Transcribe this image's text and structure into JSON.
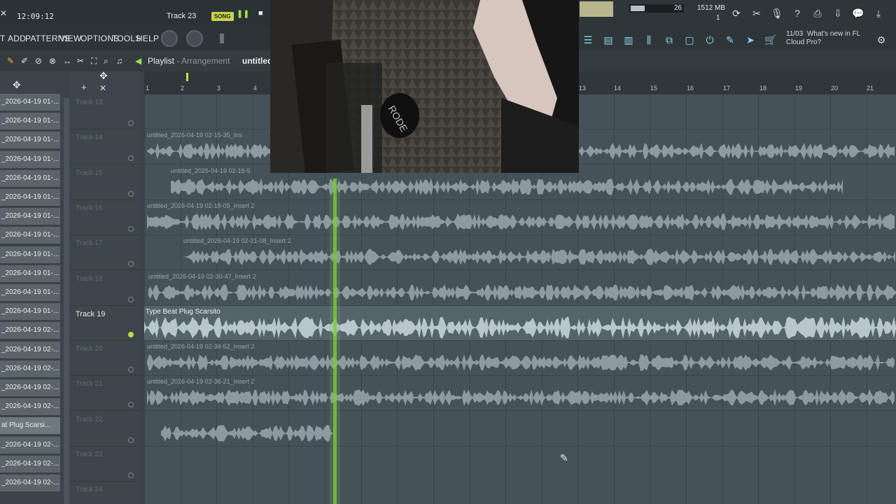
{
  "topbar": {
    "clock": "12:09:12",
    "track_hint": "Track 23",
    "song_mode": "SONG",
    "cpu_value": "26",
    "memory": "1512 MB",
    "poly": "1"
  },
  "menu": [
    "T",
    "ADD",
    "PATTERNS",
    "VIEW",
    "OPTIONS",
    "TOOLS",
    "HELP"
  ],
  "news": {
    "date": "11/03",
    "text_line1": "What's new in FL",
    "text_line2": "Cloud Pro?"
  },
  "playlist": {
    "title": "Playlist",
    "subtitle": "Arrangement",
    "project": "untitled"
  },
  "picker_items": [
    "_2026-04-19 01-...",
    "_2026-04-19 01-...",
    "_2026-04-19 01-...",
    "_2026-04-19 01-...",
    "_2026-04-19 01-...",
    "_2026-04-19 01-...",
    "_2026-04-19 01-...",
    "_2026-04-19 01-...",
    "_2026-04-19 01-...",
    "_2026-04-19 01-...",
    "_2026-04-19 01-...",
    "_2026-04-19 01-...",
    "_2026-04-19 02-...",
    "_2026-04-19 02-...",
    "_2026-04-19 02-...",
    "_2026-04-19 02-...",
    "_2026-04-19 02-...",
    "at Plug Scarsi...",
    "_2026-04-19 02-...",
    "_2026-04-19 02-...",
    "_2026-04-19 02-..."
  ],
  "tracks": [
    {
      "name": "Track 13"
    },
    {
      "name": "Track 14"
    },
    {
      "name": "Track 15"
    },
    {
      "name": "Track 16"
    },
    {
      "name": "Track 17"
    },
    {
      "name": "Track 18"
    },
    {
      "name": "Track 19"
    },
    {
      "name": "Track 20"
    },
    {
      "name": "Track 21"
    },
    {
      "name": "Track 22"
    },
    {
      "name": "Track 23"
    },
    {
      "name": "Track 24"
    }
  ],
  "clips": [
    {
      "label": "untitled_2026-04-19 02-15-35_Ins"
    },
    {
      "label": "untitled_2026-04-19 02-16-5"
    },
    {
      "label": "untitled_2026-04-19 02-18-05_Insert 2"
    },
    {
      "label": "untitled_2026-04-19 02-21-08_Insert 2"
    },
    {
      "label": "untitled_2026-04-19 02-30-47_Insert 2"
    },
    {
      "label": "Type Beat Plug Scarsito"
    },
    {
      "label": "untitled_2026-04-19 02-34-52_Insert 2"
    },
    {
      "label": "untitled_2026-04-19 02-36-21_Insert 2"
    }
  ],
  "ruler": [
    "1",
    "2",
    "3",
    "4",
    "13",
    "14",
    "15",
    "16",
    "17",
    "18",
    "19",
    "20",
    "21"
  ],
  "colors": {
    "accent": "#7ac943",
    "song_badge": "#c6d34a",
    "tool_blue": "#8dd3f0"
  }
}
